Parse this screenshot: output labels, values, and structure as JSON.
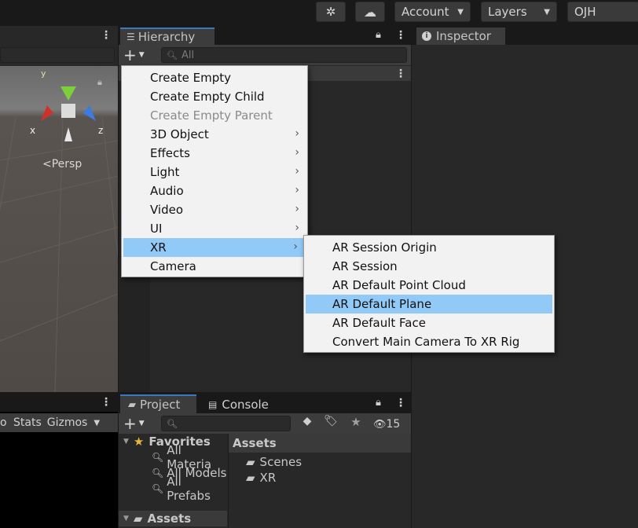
{
  "toolbar": {
    "account_label": "Account",
    "layers_label": "Layers",
    "layout_label": "OJH"
  },
  "scene": {
    "axis_y": "y",
    "axis_x": "x",
    "axis_z": "z",
    "persp_label": "Persp"
  },
  "game": {
    "stats_label": "Stats",
    "gizmos_label": "Gizmos",
    "partial_label": "o"
  },
  "hierarchy": {
    "tab_label": "Hierarchy",
    "search_placeholder": "All"
  },
  "inspector": {
    "tab_label": "Inspector"
  },
  "create_menu": {
    "items": [
      {
        "label": "Create Empty"
      },
      {
        "label": "Create Empty Child"
      },
      {
        "label": "Create Empty Parent",
        "disabled": true
      },
      {
        "label": "3D Object",
        "submenu": true
      },
      {
        "label": "Effects",
        "submenu": true
      },
      {
        "label": "Light",
        "submenu": true
      },
      {
        "label": "Audio",
        "submenu": true
      },
      {
        "label": "Video",
        "submenu": true
      },
      {
        "label": "UI",
        "submenu": true
      },
      {
        "label": "XR",
        "submenu": true,
        "selected": true
      },
      {
        "label": "Camera"
      }
    ]
  },
  "xr_menu": {
    "items": [
      {
        "label": "AR Session Origin"
      },
      {
        "label": "AR Session"
      },
      {
        "label": "AR Default Point Cloud"
      },
      {
        "label": "AR Default Plane",
        "selected": true
      },
      {
        "label": "AR Default Face"
      },
      {
        "label": "Convert Main Camera To XR Rig"
      }
    ]
  },
  "project": {
    "tab_project": "Project",
    "tab_console": "Console",
    "hidden_count": "15",
    "favorites_label": "Favorites",
    "favorites": [
      "All Materia",
      "All Models",
      "All Prefabs"
    ],
    "assets_root_label": "Assets",
    "assets_header": "Assets",
    "assets": [
      "Scenes",
      "XR"
    ]
  },
  "colors": {
    "menu_highlight": "#91c9f7",
    "panel_bg": "#282828",
    "gizmo_y": "#7ccf3a",
    "gizmo_x": "#d2312a",
    "gizmo_z": "#3a7ce0"
  }
}
